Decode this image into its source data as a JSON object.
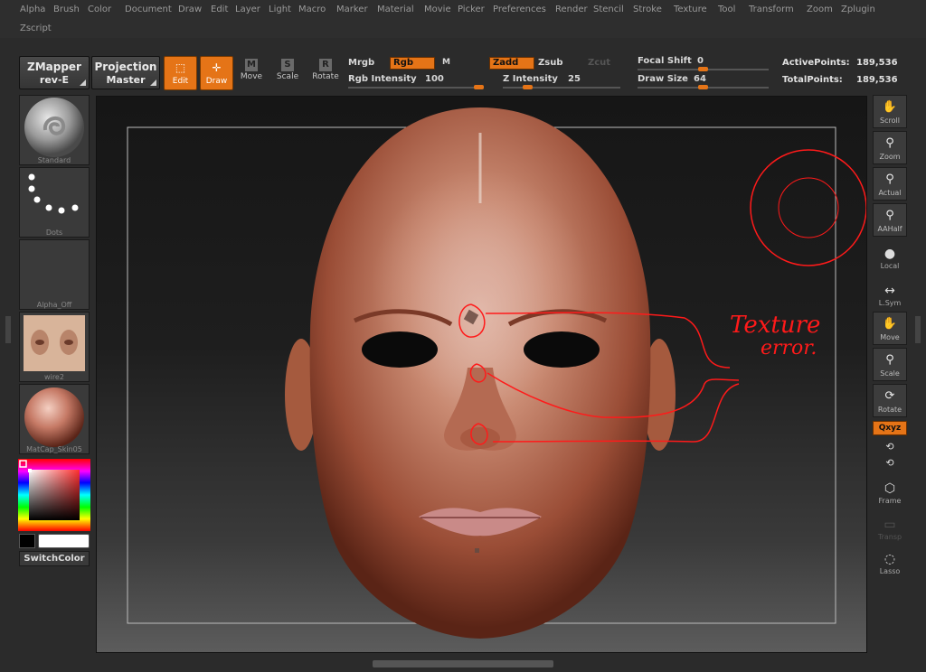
{
  "menu": [
    "Alpha",
    "Brush",
    "Color",
    "Document",
    "Draw",
    "Edit",
    "Layer",
    "Light",
    "Macro",
    "Marker",
    "Material",
    "Movie",
    "Picker",
    "Preferences",
    "Render",
    "Stencil",
    "Stroke",
    "Texture",
    "Tool",
    "Transform",
    "Zoom",
    "Zplugin",
    "Zscript"
  ],
  "toolbar": {
    "zmapper": {
      "line1": "ZMapper",
      "line2": "rev-E"
    },
    "projection": {
      "line1": "Projection",
      "line2": "Master"
    },
    "edit": "Edit",
    "draw": "Draw",
    "move": "Move",
    "scale": "Scale",
    "rotate": "Rotate",
    "mrgb": "Mrgb",
    "rgb": "Rgb",
    "m": "M",
    "rgb_intensity": {
      "label": "Rgb Intensity",
      "value": "100"
    },
    "zadd": "Zadd",
    "zsub": "Zsub",
    "zcut": "Zcut",
    "z_intensity": {
      "label": "Z Intensity",
      "value": "25"
    },
    "focal_shift": {
      "label": "Focal Shift",
      "value": "0"
    },
    "draw_size": {
      "label": "Draw Size",
      "value": "64"
    },
    "active_points": {
      "label": "ActivePoints:",
      "value": "189,536"
    },
    "total_points": {
      "label": "TotalPoints:",
      "value": "189,536"
    }
  },
  "left_shelf": {
    "brush": "Standard",
    "stroke": "Dots",
    "alpha": "Alpha_Off",
    "texture": "wire2",
    "material": "MatCap_Skin05",
    "switch_color": "SwitchColor"
  },
  "right_shelf": {
    "scroll": "Scroll",
    "zoom": "Zoom",
    "actual": "Actual",
    "aahalf": "AAHalf",
    "local": "Local",
    "lsym": "L.Sym",
    "move": "Move",
    "scale": "Scale",
    "rotate": "Rotate",
    "xyz": "Qxyz",
    "frame": "Frame",
    "transp": "Transp",
    "lasso": "Lasso"
  },
  "annotation": {
    "line1": "Texture",
    "line2": "error."
  },
  "colors": {
    "accent": "#e57417",
    "annotation": "#ff1a1a",
    "background": "#2b2b2b"
  }
}
